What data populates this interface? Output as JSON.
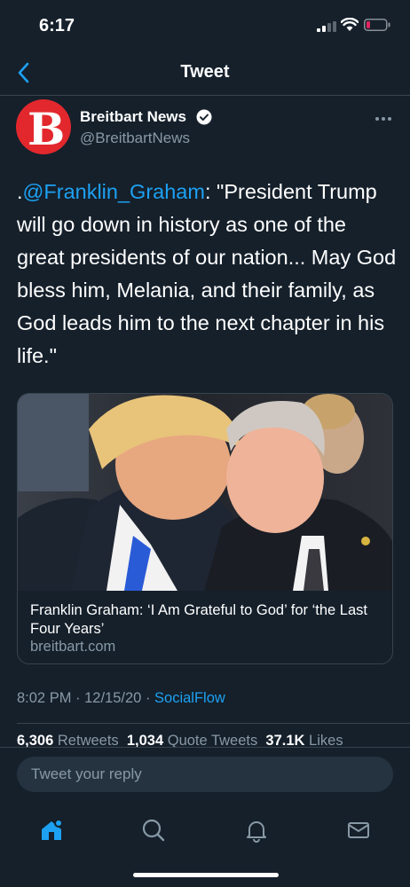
{
  "status_bar": {
    "time": "6:17"
  },
  "nav": {
    "title": "Tweet"
  },
  "author": {
    "avatar_letter": "B",
    "name": "Breitbart News",
    "handle": "@BreitbartNews"
  },
  "tweet": {
    "prefix": ".",
    "mention": "@Franklin_Graham",
    "body": ": \"President Trump will go down in history as one of the great presidents of our nation... May God bless him, Melania, and their family, as God leads him to the next chapter in his life.\""
  },
  "card": {
    "title": "Franklin Graham: ‘I Am Grateful to God’ for ‘the Last Four Years’",
    "domain": "breitbart.com"
  },
  "meta": {
    "time": "8:02 PM",
    "date": "12/15/20",
    "separator": " · ",
    "source": "SocialFlow"
  },
  "stats": {
    "retweets_count": "6,306",
    "retweets_label": "Retweets",
    "quotes_count": "1,034",
    "quotes_label": "Quote Tweets",
    "likes_count": "37.1K",
    "likes_label": "Likes"
  },
  "reply": {
    "placeholder": "Tweet your reply"
  },
  "colors": {
    "background": "#15202b",
    "accent": "#1da1f2",
    "secondary_text": "#8899a6",
    "battery_low": "#e0245e",
    "brand_red": "#e2282d"
  },
  "icons": {
    "back": "chevron-left-icon",
    "verified": "verified-badge-icon",
    "more": "ellipsis-icon",
    "home": "home-icon",
    "search": "search-icon",
    "notifications": "bell-icon",
    "messages": "envelope-icon"
  }
}
